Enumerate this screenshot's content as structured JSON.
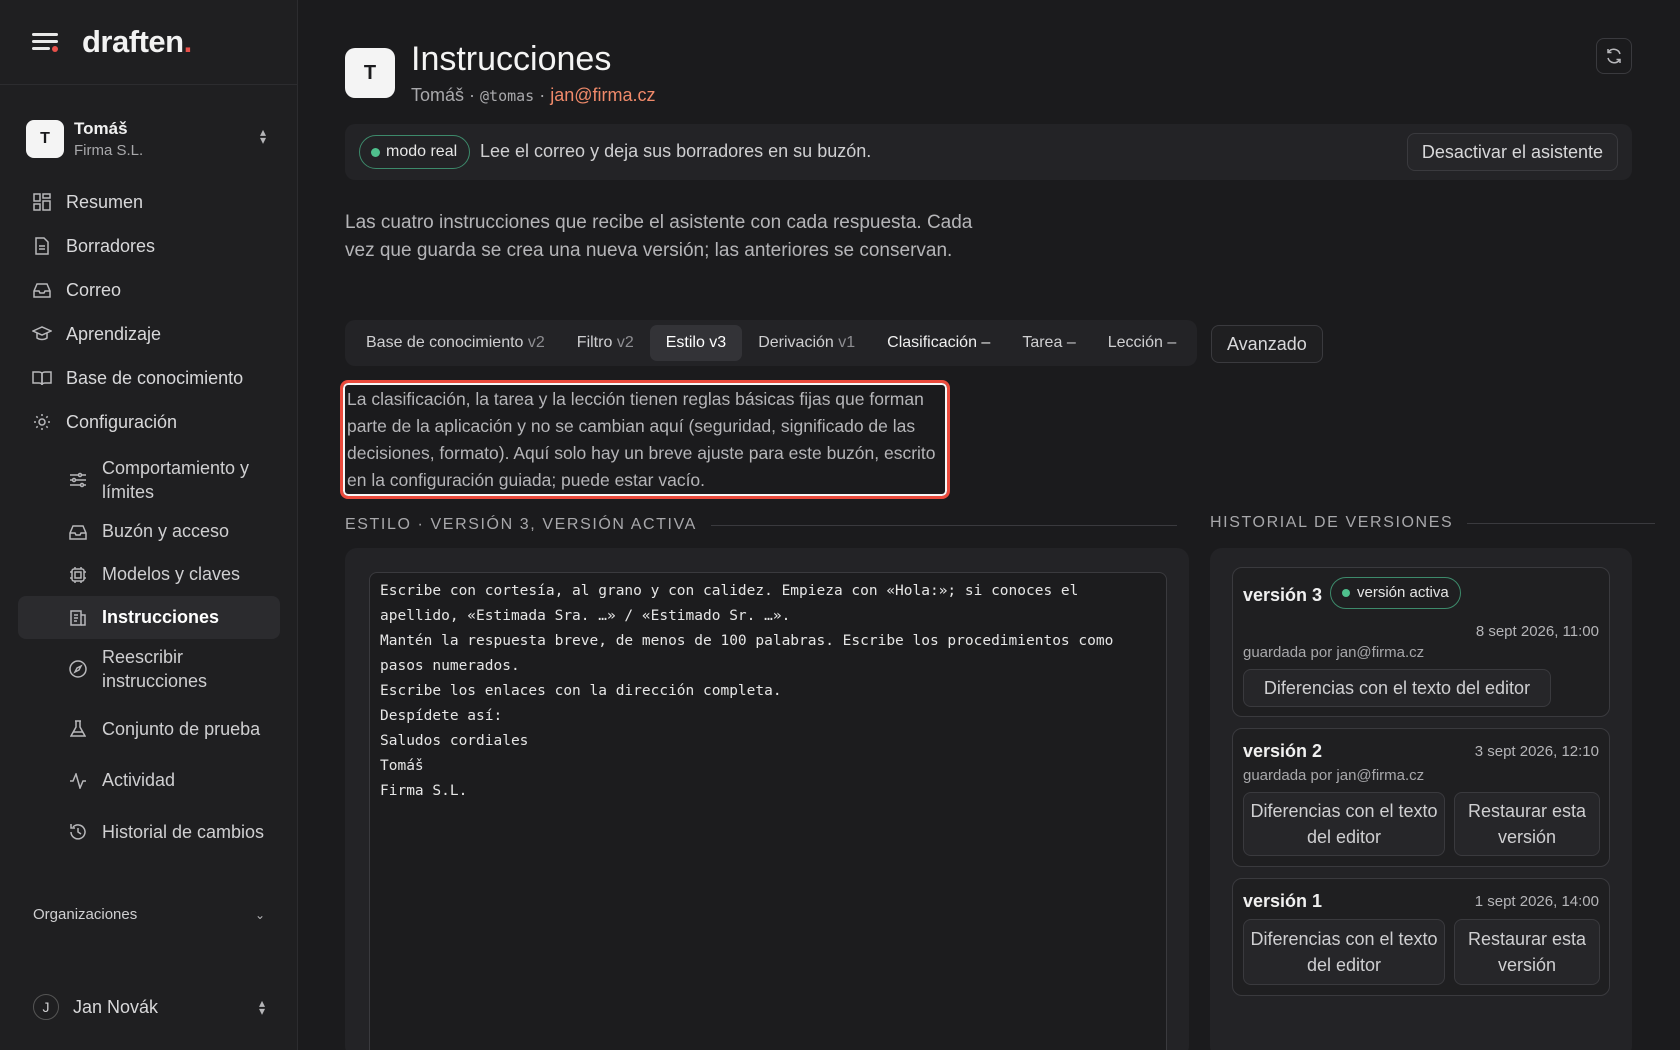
{
  "brand": {
    "name": "draften",
    "accent": "."
  },
  "account": {
    "initial": "T",
    "name": "Tomáš",
    "org": "Firma S.L."
  },
  "nav": [
    {
      "label": "Resumen",
      "icon": "dashboard-icon"
    },
    {
      "label": "Borradores",
      "icon": "document-icon"
    },
    {
      "label": "Correo",
      "icon": "inbox-icon"
    },
    {
      "label": "Aprendizaje",
      "icon": "graduation-cap-icon"
    },
    {
      "label": "Base de conocimiento",
      "icon": "book-icon"
    },
    {
      "label": "Configuración",
      "icon": "gear-icon"
    }
  ],
  "subnav": [
    {
      "label": "Comportamiento y límites",
      "icon": "sliders-icon"
    },
    {
      "label": "Buzón y acceso",
      "icon": "inbox-icon"
    },
    {
      "label": "Modelos y claves",
      "icon": "cpu-icon"
    },
    {
      "label": "Instrucciones",
      "icon": "instructions-icon",
      "active": true
    },
    {
      "label": "Reescribir instrucciones",
      "icon": "compass-icon"
    },
    {
      "label": "Conjunto de prueba",
      "icon": "flask-icon"
    },
    {
      "label": "Actividad",
      "icon": "activity-icon"
    },
    {
      "label": "Historial de cambios",
      "icon": "history-icon"
    }
  ],
  "orgs_label": "Organizaciones",
  "user": {
    "initial": "J",
    "name": "Jan Novák"
  },
  "page": {
    "initial": "T",
    "title": "Instrucciones",
    "sub_name": "Tomáš ·",
    "sub_handle": "@tomas",
    "sub_sep": "·",
    "sub_email": "jan@firma.cz"
  },
  "mode": {
    "badge": "modo real",
    "text": "Lee el correo y deja sus borradores en su buzón.",
    "button": "Desactivar el asistente"
  },
  "intro": "Las cuatro instrucciones que recibe el asistente con cada respuesta. Cada vez que guarda se crea una nueva versión; las anteriores se conservan.",
  "tabs": [
    {
      "label": "Base de conocimiento",
      "ver": "v2"
    },
    {
      "label": "Filtro",
      "ver": "v2"
    },
    {
      "label": "Estilo",
      "ver": "v3",
      "active": true
    },
    {
      "label": "Derivación",
      "ver": "v1"
    },
    {
      "label": "Clasificación",
      "ver": "–"
    },
    {
      "label": "Tarea",
      "ver": "–"
    },
    {
      "label": "Lección",
      "ver": "–"
    }
  ],
  "advanced_label": "Avanzado",
  "note": "La clasificación, la tarea y la lección tienen reglas básicas fijas que forman parte de la aplicación y no se cambian aquí (seguridad, significado de las decisiones, formato). Aquí solo hay un breve ajuste para este buzón, escrito en la configuración guiada; puede estar vacío.",
  "editor": {
    "heading": "ESTILO · VERSIÓN 3, VERSIÓN ACTIVA",
    "content": "Escribe con cortesía, al grano y con calidez. Empieza con «Hola:»; si conoces el apellido, «Estimada Sra. …» / «Estimado Sr. …».\nMantén la respuesta breve, de menos de 100 palabras. Escribe los procedimientos como pasos numerados.\nEscribe los enlaces con la dirección completa.\nDespídete así:\nSaludos cordiales\nTomáš\nFirma S.L."
  },
  "history": {
    "heading": "HISTORIAL DE VERSIONES",
    "versions": [
      {
        "title": "versión 3",
        "badge": "versión activa",
        "date": "8 sept 2026, 11:00",
        "by": "guardada por jan@firma.cz",
        "diff": "Diferencias con el texto del editor"
      },
      {
        "title": "versión 2",
        "date": "3 sept 2026, 12:10",
        "by": "guardada por jan@firma.cz",
        "diff": "Diferencias con el texto del editor",
        "restore": "Restaurar esta versión"
      },
      {
        "title": "versión 1",
        "date": "1 sept 2026, 14:00",
        "diff": "Diferencias con el texto del editor",
        "restore": "Restaurar esta versión"
      }
    ]
  },
  "colors": {
    "accent": "#e8504a",
    "email": "#f08a6a",
    "active_green": "#4fc08d",
    "highlight": "#ea4a3c"
  }
}
